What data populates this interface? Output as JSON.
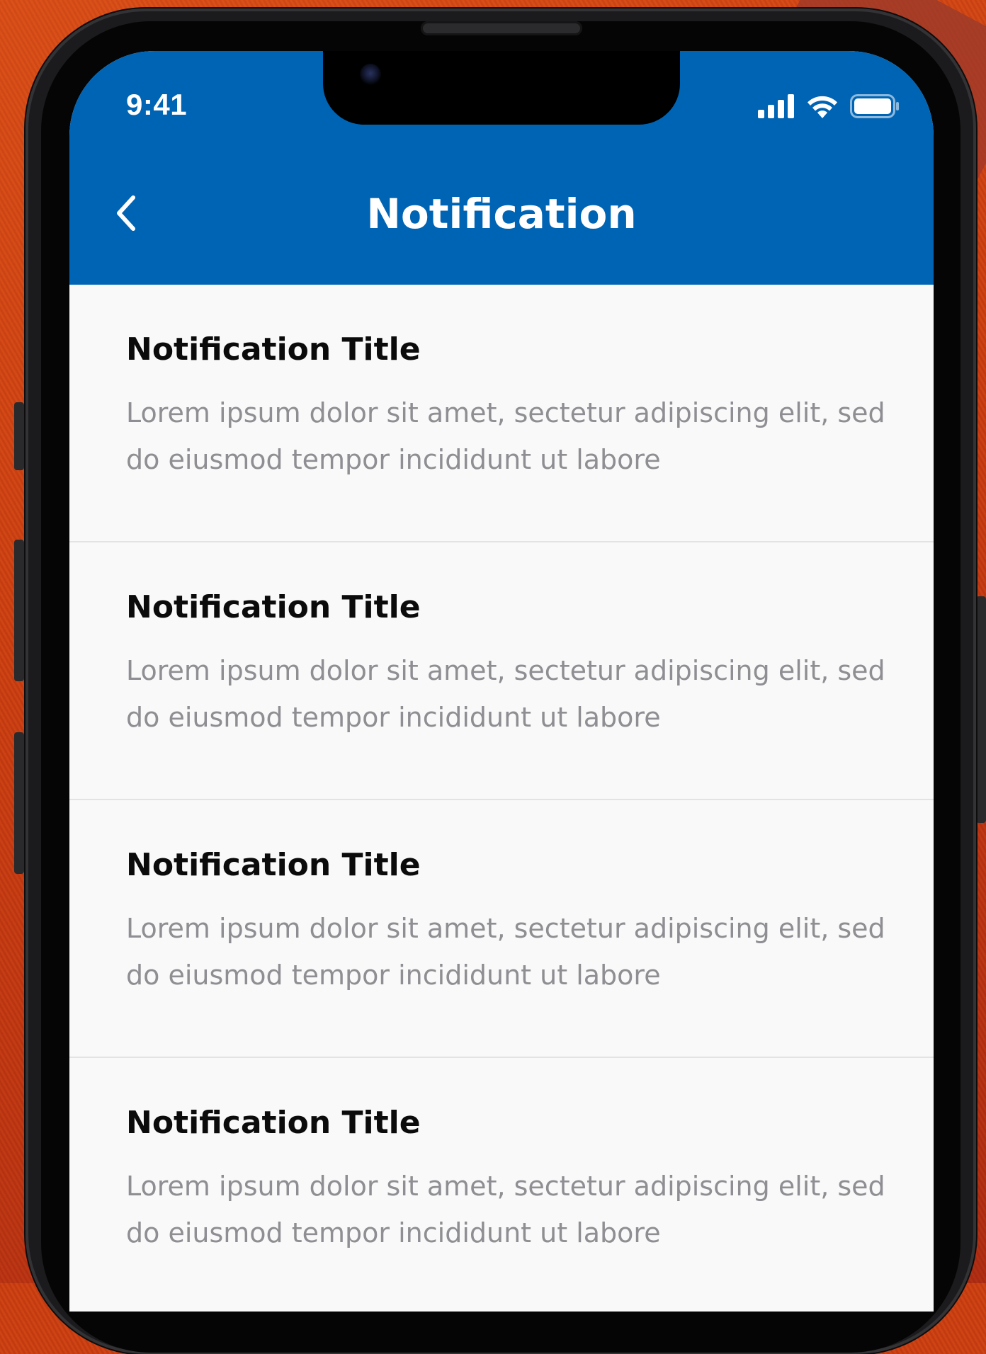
{
  "status_bar": {
    "time": "9:41"
  },
  "header": {
    "title": "Notification",
    "background_color": "#0064b4"
  },
  "notifications": [
    {
      "title": "Notification Title",
      "body": "Lorem ipsum dolor sit amet, sectetur adipiscing elit, sed do eiusmod tempor incididunt ut labore"
    },
    {
      "title": "Notification Title",
      "body": "Lorem ipsum dolor sit amet, sectetur adipiscing elit, sed do eiusmod tempor incididunt ut labore"
    },
    {
      "title": "Notification Title",
      "body": "Lorem ipsum dolor sit amet, sectetur adipiscing elit, sed do eiusmod tempor incididunt ut labore"
    },
    {
      "title": "Notification Title",
      "body": "Lorem ipsum dolor sit amet, sectetur adipiscing elit, sed do eiusmod tempor incididunt ut labore"
    }
  ],
  "icons": {
    "back": "chevron-left-icon",
    "signal": "cellular-signal-icon",
    "wifi": "wifi-icon",
    "battery": "battery-icon"
  }
}
